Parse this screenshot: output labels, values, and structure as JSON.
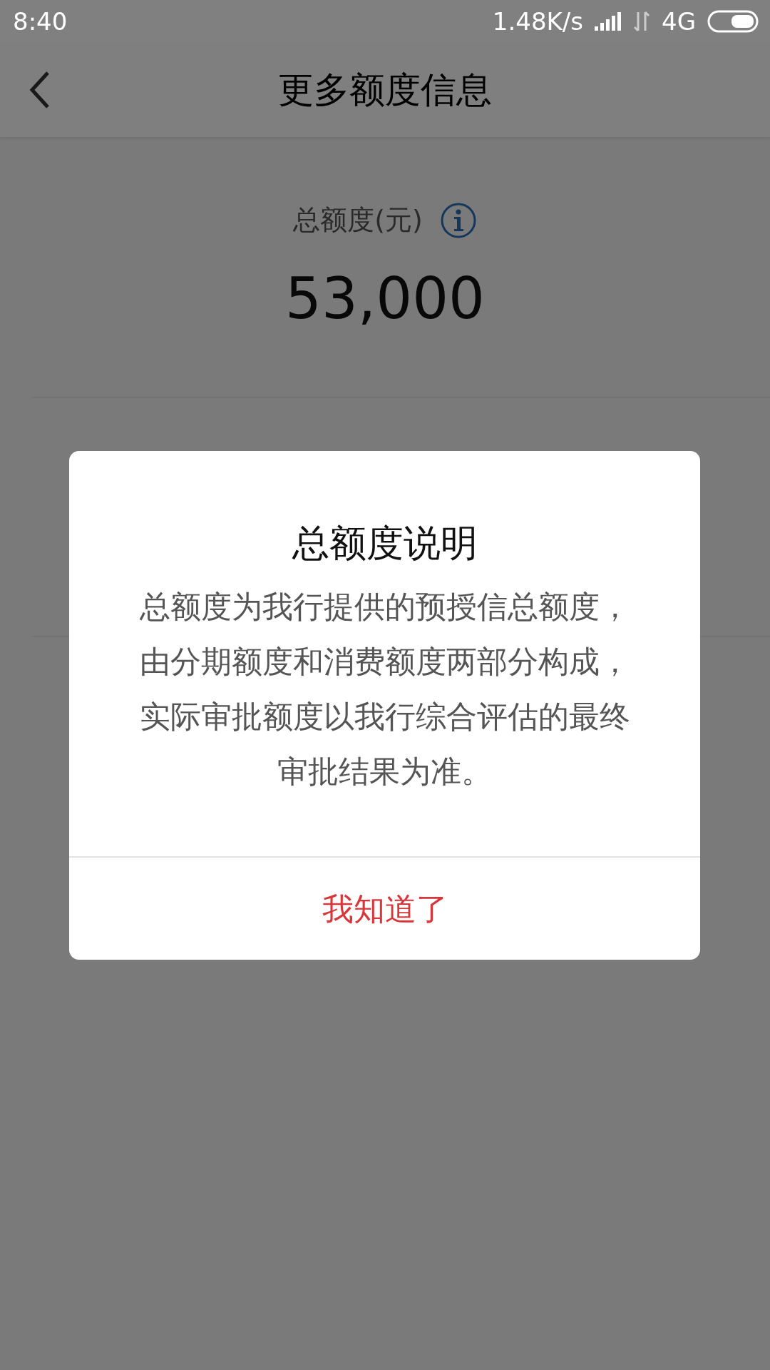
{
  "status_bar": {
    "time": "8:40",
    "speed": "1.48K/s",
    "network": "4G"
  },
  "header": {
    "title": "更多额度信息"
  },
  "sections": [
    {
      "label": "总额度(元)",
      "value": "53,000"
    }
  ],
  "dialog": {
    "title": "总额度说明",
    "body": "总额度为我行提供的预授信总额度，由分期额度和消费额度两部分构成，实际审批额度以我行综合评估的最终审批结果为准。",
    "button": "我知道了"
  }
}
